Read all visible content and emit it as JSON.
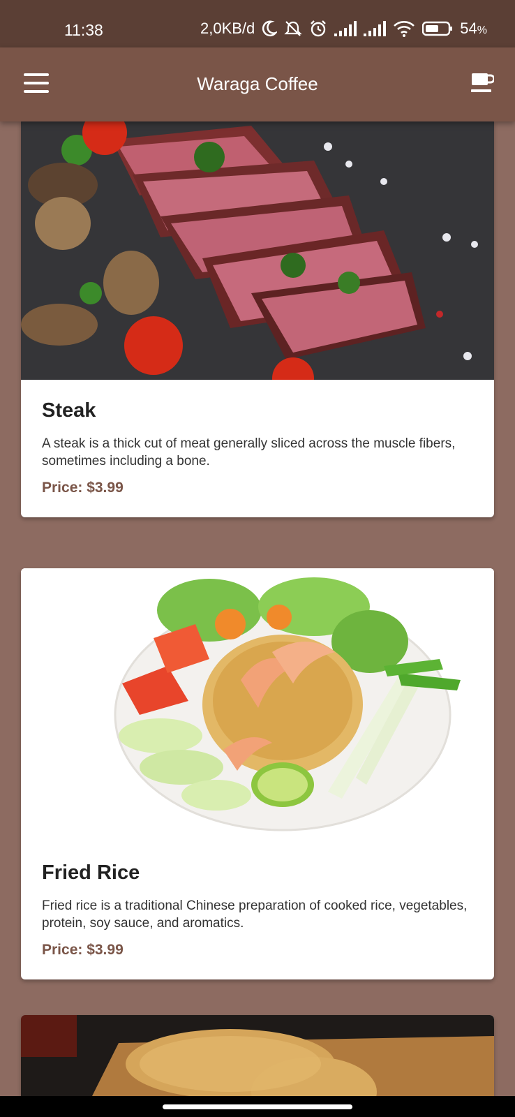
{
  "status_bar": {
    "time": "11:38",
    "network_speed": "2,0KB/d",
    "battery_percent": "54",
    "battery_suffix": "%",
    "icons": [
      "moon-icon",
      "alarm-off-icon",
      "alarm-icon",
      "signal-icon",
      "signal-icon",
      "wifi-icon",
      "battery-icon"
    ]
  },
  "app_bar": {
    "title": "Waraga Coffee",
    "menu_icon": "hamburger-menu-icon",
    "action_icon": "coffee-cup-icon"
  },
  "menu_items": [
    {
      "name": "Steak",
      "description": "A steak is a thick cut of meat generally sliced across the muscle fibers, sometimes including a bone.",
      "price": "Price: $3.99",
      "image": "steak-photo"
    },
    {
      "name": "Fried Rice",
      "description": "Fried rice is a traditional Chinese preparation of cooked rice, vegetables, protein, soy sauce, and aromatics.",
      "price": "Price: $3.99",
      "image": "fried-rice-photo"
    },
    {
      "image": "fried-food-photo"
    }
  ],
  "colors": {
    "status_bar": "#5b3f35",
    "app_bar": "#7a5548",
    "background": "#8d6b61",
    "price": "#7a5548"
  }
}
